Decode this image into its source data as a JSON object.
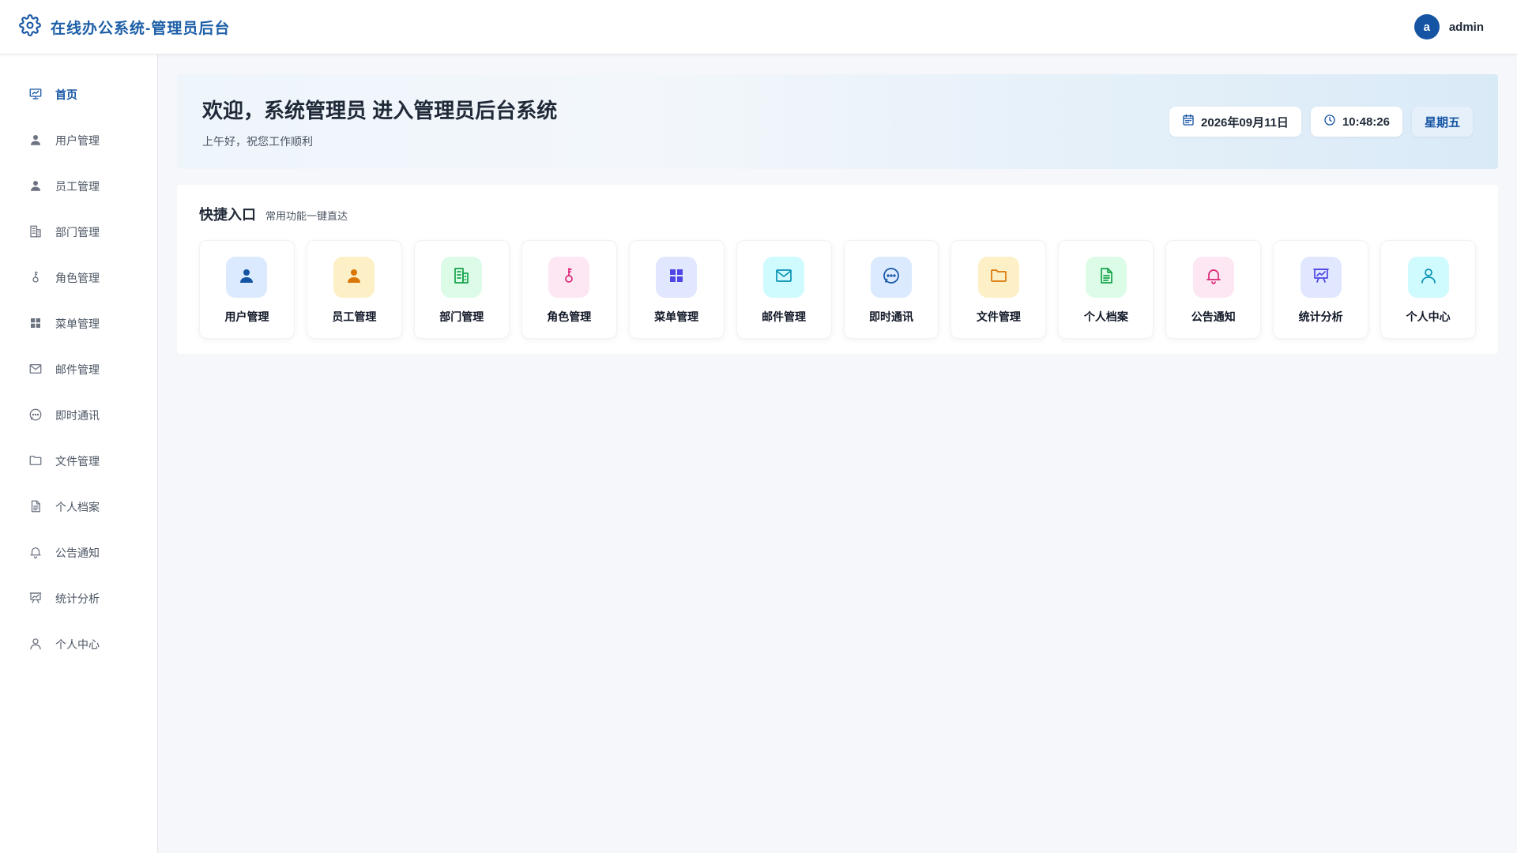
{
  "header": {
    "title": "在线办公系统-管理员后台",
    "icon": "gear-icon",
    "user": {
      "avatar_letter": "a",
      "name": "admin"
    }
  },
  "colors": {
    "brand": "#1554a3",
    "sidebar_active": "#1554a3",
    "page_bg": "#f5f7fa"
  },
  "sidebar": {
    "items": [
      {
        "label": "首页",
        "icon": "dashboard-icon",
        "active": true
      },
      {
        "label": "用户管理",
        "icon": "user-icon"
      },
      {
        "label": "员工管理",
        "icon": "user-icon"
      },
      {
        "label": "部门管理",
        "icon": "building-icon"
      },
      {
        "label": "角色管理",
        "icon": "key-icon"
      },
      {
        "label": "菜单管理",
        "icon": "grid-icon"
      },
      {
        "label": "邮件管理",
        "icon": "mail-icon"
      },
      {
        "label": "即时通讯",
        "icon": "chat-icon"
      },
      {
        "label": "文件管理",
        "icon": "folder-icon"
      },
      {
        "label": "个人档案",
        "icon": "document-icon"
      },
      {
        "label": "公告通知",
        "icon": "bell-icon"
      },
      {
        "label": "统计分析",
        "icon": "presentation-icon"
      },
      {
        "label": "个人中心",
        "icon": "profile-icon"
      }
    ]
  },
  "welcome": {
    "title": "欢迎，系统管理员 进入管理员后台系统",
    "subtitle": "上午好，祝您工作顺利",
    "date": "2026年09月11日",
    "time": "10:48:26",
    "weekday": "星期五"
  },
  "quick": {
    "title": "快捷入口",
    "subtitle": "常用功能一键直达",
    "tiles": [
      {
        "label": "用户管理",
        "icon": "user-icon",
        "bg": "#dbeafe",
        "fg": "#1554a3"
      },
      {
        "label": "员工管理",
        "icon": "user-icon",
        "bg": "#fdf0c7",
        "fg": "#d97706"
      },
      {
        "label": "部门管理",
        "icon": "building-icon",
        "bg": "#dcfce7",
        "fg": "#16a34a"
      },
      {
        "label": "角色管理",
        "icon": "key-icon",
        "bg": "#fce7f3",
        "fg": "#db2777"
      },
      {
        "label": "菜单管理",
        "icon": "grid-icon",
        "bg": "#e0e7ff",
        "fg": "#4f46e5"
      },
      {
        "label": "邮件管理",
        "icon": "mail-icon",
        "bg": "#cffafe",
        "fg": "#0891b2"
      },
      {
        "label": "即时通讯",
        "icon": "chat-icon",
        "bg": "#dbeafe",
        "fg": "#1554a3"
      },
      {
        "label": "文件管理",
        "icon": "folder-icon",
        "bg": "#fdf0c7",
        "fg": "#d97706"
      },
      {
        "label": "个人档案",
        "icon": "document-icon",
        "bg": "#dcfce7",
        "fg": "#16a34a"
      },
      {
        "label": "公告通知",
        "icon": "bell-icon",
        "bg": "#fce7f3",
        "fg": "#db2777"
      },
      {
        "label": "统计分析",
        "icon": "presentation-icon",
        "bg": "#e0e7ff",
        "fg": "#4f46e5"
      },
      {
        "label": "个人中心",
        "icon": "profile-icon",
        "bg": "#cffafe",
        "fg": "#0891b2"
      }
    ]
  }
}
